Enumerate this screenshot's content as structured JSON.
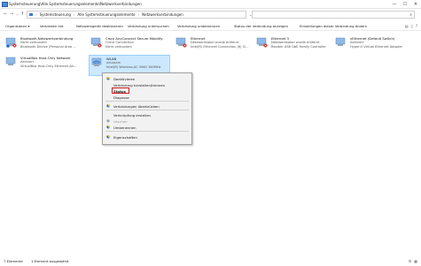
{
  "window": {
    "title": "Systemsteuerung\\Alle Systemsteuerungselemente\\Netzwerkverbindungen",
    "minimize": "—",
    "maximize": "☐",
    "close": "✕"
  },
  "nav": {
    "back": "←",
    "forward": "→",
    "history": "⌄",
    "up": "↑"
  },
  "address": {
    "crumbs": [
      "Systemsteuerung",
      "Alle Systemsteuerungselemente",
      "Netzwerkverbindungen"
    ],
    "separator": "›",
    "dropdown": "⌄",
    "refresh": "↻"
  },
  "search": {
    "placeholder": "",
    "icon": "search-icon"
  },
  "commands": [
    "Organisieren ▾",
    "Verbinden mit",
    "Netzwerkgerät deaktivieren",
    "Verbindung untersuchen",
    "Verbindung umbenennen",
    "Status der Verbindung anzeigen",
    "Einstellungen dieser Verbindung ändern"
  ],
  "connections": [
    {
      "name": "Bluetooth-Netzwerkverbindung",
      "status": "Nicht verbunden",
      "device": "Bluetooth Device (Personal Area ...",
      "badge": "error"
    },
    {
      "name": "Cisco AnyConnect Secure Mobility",
      "status": "Client Connection",
      "device": "Nicht verbunden",
      "badge": "error"
    },
    {
      "name": "Ethernet",
      "status": "Netzwerkkabel wurde entfernt",
      "device": "Intel(R) Ethernet Connection (6) I2...",
      "badge": "error"
    },
    {
      "name": "Ethernet 3",
      "status": "Netzwerkkabel wurde entfernt",
      "device": "Realtek USB GbE Family Controller",
      "badge": "error"
    },
    {
      "name": "vEthernet (Default Switch)",
      "status": "Aktiviert",
      "device": "Hyper-V Virtual Ethernet Adapter",
      "badge": "none"
    },
    {
      "name": "VirtualBox Host-Only Network",
      "status": "Aktiviert",
      "device": "VirtualBox Host-Only Ethernet Ad...",
      "badge": "none"
    },
    {
      "name": "WLAN",
      "status": "eduroam",
      "device": "Intel(R) Wireless-AC 9560 160MHz",
      "badge": "wifi"
    }
  ],
  "context_menu": {
    "items": [
      {
        "label": "Deaktivieren",
        "shield": true
      },
      {
        "label": "Verbindung herstellen/trennen",
        "shield": false
      },
      {
        "label": "Status",
        "shield": false
      },
      {
        "label": "Diagnose",
        "shield": false
      },
      {
        "label": "Verbindungen überbrücken",
        "shield": true
      },
      {
        "label": "Verknüpfung erstellen",
        "shield": false
      },
      {
        "label": "Löschen",
        "shield": true
      },
      {
        "label": "Umbenennen",
        "shield": true
      },
      {
        "label": "Eigenschaften",
        "shield": true
      }
    ]
  },
  "statusbar": {
    "count": "7 Elemente",
    "selected": "1 Element ausgewählt"
  },
  "colors": {
    "selection": "#cce8ff",
    "highlight_border": "#d01b1b",
    "error_badge": "#d01b1b",
    "shield_blue": "#2d6fd0",
    "shield_yellow": "#f2c200"
  }
}
